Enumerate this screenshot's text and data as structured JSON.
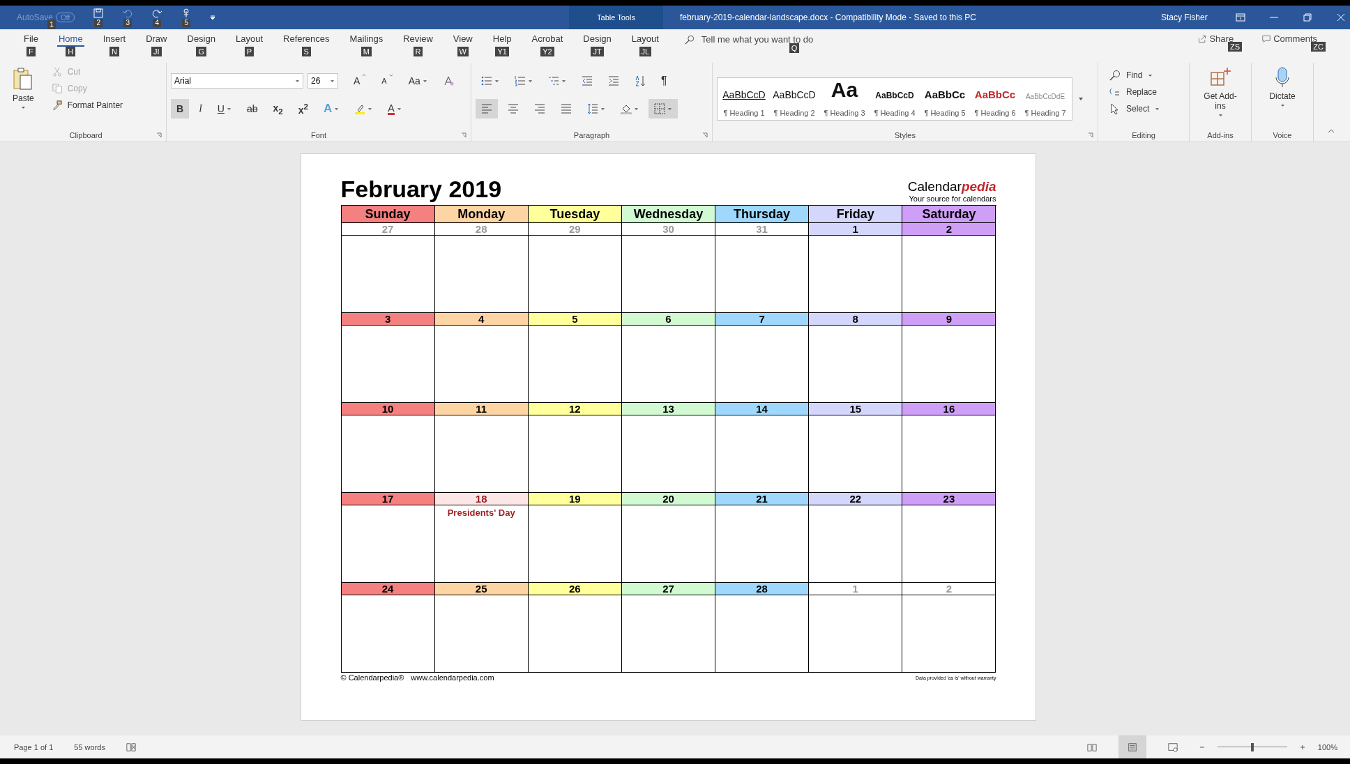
{
  "title_bar": {
    "autosave": {
      "label": "AutoSave",
      "keytip": "1",
      "on": false,
      "state_text": "Off"
    },
    "quick_access": [
      {
        "kind": "save",
        "keytip": "2",
        "disabled": false
      },
      {
        "kind": "undo",
        "keytip": "3",
        "disabled": true
      },
      {
        "kind": "redo",
        "keytip": "4",
        "disabled": false
      },
      {
        "kind": "touch",
        "keytip": "5",
        "disabled": false
      }
    ],
    "context_label": "Table Tools",
    "document_title": "february-2019-calendar-landscape.docx  -  Compatibility Mode  -  Saved to this PC",
    "user": "Stacy Fisher"
  },
  "tabs": [
    {
      "label": "File",
      "keytip": "F",
      "selected": false
    },
    {
      "label": "Home",
      "keytip": "H",
      "selected": true
    },
    {
      "label": "Insert",
      "keytip": "N",
      "selected": false
    },
    {
      "label": "Draw",
      "keytip": "JI",
      "selected": false
    },
    {
      "label": "Design",
      "keytip": "G",
      "selected": false
    },
    {
      "label": "Layout",
      "keytip": "P",
      "selected": false
    },
    {
      "label": "References",
      "keytip": "S",
      "selected": false
    },
    {
      "label": "Mailings",
      "keytip": "M",
      "selected": false
    },
    {
      "label": "Review",
      "keytip": "R",
      "selected": false
    },
    {
      "label": "View",
      "keytip": "W",
      "selected": false
    },
    {
      "label": "Help",
      "keytip": "Y1",
      "selected": false
    },
    {
      "label": "Acrobat",
      "keytip": "Y2",
      "selected": false
    },
    {
      "label": "Design",
      "keytip": "JT",
      "selected": false
    },
    {
      "label": "Layout",
      "keytip": "JL",
      "selected": false
    }
  ],
  "tell_me": {
    "placeholder": "Tell me what you want to do",
    "keytip": "Q"
  },
  "share": {
    "label": "Share",
    "keytip": "ZS"
  },
  "comments": {
    "label": "Comments",
    "keytip": "ZC"
  },
  "clipboard": {
    "title": "Clipboard",
    "paste": "Paste",
    "items": [
      {
        "kind": "cut",
        "label": "Cut",
        "disabled": true
      },
      {
        "kind": "copy",
        "label": "Copy",
        "disabled": true
      },
      {
        "kind": "brush",
        "label": "Format Painter",
        "disabled": false
      }
    ]
  },
  "font": {
    "title": "Font",
    "name": "Arial",
    "size": "26",
    "row1": [
      {
        "kind": "text",
        "label": "A"
      },
      {
        "kind": "text",
        "label": "A"
      },
      {
        "kind": "text",
        "label": "Aa",
        "dropdown": true
      },
      {
        "kind": "clear"
      }
    ],
    "row2": [
      {
        "kind": "text",
        "label": "B",
        "selected": true
      },
      {
        "kind": "text",
        "label": "I",
        "selected": false
      },
      {
        "kind": "text",
        "label": "U",
        "selected": false,
        "dropdown": true
      },
      {
        "kind": "text",
        "label": "ab",
        "selected": false
      },
      {
        "kind": "text",
        "label": "x$_{2}$",
        "selected": false
      },
      {
        "kind": "text",
        "label": "x$^{2}$",
        "selected": false
      },
      {
        "kind": "text",
        "label": "A",
        "selected": false,
        "dropdown": true
      },
      {
        "kind": "highlight",
        "selected": false,
        "dropdown": true
      },
      {
        "kind": "text",
        "label": "A",
        "selected": false,
        "dropdown": true
      }
    ]
  },
  "paragraph": {
    "title": "Paragraph",
    "row1": [
      {
        "kind": "bullets",
        "selected": false,
        "dropdown": true
      },
      {
        "kind": "numbering",
        "selected": false,
        "dropdown": true
      },
      {
        "kind": "multilevel",
        "selected": false,
        "dropdown": true
      },
      {
        "kind": "outdent",
        "selected": false
      },
      {
        "kind": "indent",
        "selected": false
      },
      {
        "kind": "sort",
        "selected": false
      },
      {
        "kind": "text",
        "label": "¶",
        "selected": false
      }
    ],
    "row2": [
      {
        "kind": "left",
        "selected": true
      },
      {
        "kind": "center",
        "selected": false
      },
      {
        "kind": "right",
        "selected": false
      },
      {
        "kind": "justify",
        "selected": false
      },
      {
        "kind": "spacing",
        "selected": false,
        "dropdown": true
      },
      {
        "kind": "shading",
        "selected": false,
        "dropdown": true
      },
      {
        "kind": "borders",
        "selected": true,
        "dropdown": true
      }
    ]
  },
  "styles": {
    "title": "Styles",
    "items": [
      {
        "sample": "AaBbCcD",
        "label": "¶ Heading 1",
        "kind": "h1"
      },
      {
        "sample": "AaBbCcD",
        "label": "¶ Heading 2",
        "kind": "h2"
      },
      {
        "sample": "Aa",
        "label": "¶ Heading 3",
        "kind": "h3"
      },
      {
        "sample": "AaBbCcD",
        "label": "¶ Heading 4",
        "kind": "h4"
      },
      {
        "sample": "AaBbCc",
        "label": "¶ Heading 5",
        "kind": "h5"
      },
      {
        "sample": "AaBbCc",
        "label": "¶ Heading 6",
        "kind": "h6"
      },
      {
        "sample": "AaBbCcDdE",
        "label": "¶ Heading 7",
        "kind": "h7"
      }
    ]
  },
  "editing": {
    "title": "Editing",
    "items": [
      {
        "kind": "find",
        "label": "Find",
        "dropdown": true
      },
      {
        "kind": "replace",
        "label": "Replace",
        "dropdown": false
      },
      {
        "kind": "select",
        "label": "Select",
        "dropdown": true
      }
    ]
  },
  "addins": {
    "title": "Add-ins",
    "label": "Get Add-ins"
  },
  "voice": {
    "title": "Voice",
    "label": "Dictate"
  },
  "calendar": {
    "title": "February 2019",
    "logo": {
      "main": "Calendar",
      "accent": "pedia"
    },
    "tagline": "Your source for calendars",
    "weekdays": [
      {
        "name": "Sunday",
        "color": "#f58080"
      },
      {
        "name": "Monday",
        "color": "#fdd5a5"
      },
      {
        "name": "Tuesday",
        "color": "#ffff9c"
      },
      {
        "name": "Wednesday",
        "color": "#d2fad2"
      },
      {
        "name": "Thursday",
        "color": "#9fd8fc"
      },
      {
        "name": "Friday",
        "color": "#d4d6fc"
      },
      {
        "name": "Saturday",
        "color": "#cf9ff8"
      }
    ],
    "weeks": [
      [
        {
          "day": "27",
          "kind": "outside"
        },
        {
          "day": "28",
          "kind": "outside"
        },
        {
          "day": "29",
          "kind": "outside"
        },
        {
          "day": "30",
          "kind": "outside"
        },
        {
          "day": "31",
          "kind": "outside"
        },
        {
          "day": "1",
          "kind": "normal"
        },
        {
          "day": "2",
          "kind": "normal"
        }
      ],
      [
        {
          "day": "3",
          "kind": "normal"
        },
        {
          "day": "4",
          "kind": "normal"
        },
        {
          "day": "5",
          "kind": "normal"
        },
        {
          "day": "6",
          "kind": "normal"
        },
        {
          "day": "7",
          "kind": "normal"
        },
        {
          "day": "8",
          "kind": "normal"
        },
        {
          "day": "9",
          "kind": "normal"
        }
      ],
      [
        {
          "day": "10",
          "kind": "normal"
        },
        {
          "day": "11",
          "kind": "normal"
        },
        {
          "day": "12",
          "kind": "normal"
        },
        {
          "day": "13",
          "kind": "normal"
        },
        {
          "day": "14",
          "kind": "normal"
        },
        {
          "day": "15",
          "kind": "normal"
        },
        {
          "day": "16",
          "kind": "normal"
        }
      ],
      [
        {
          "day": "17",
          "kind": "normal"
        },
        {
          "day": "18",
          "kind": "holiday",
          "color": "#fde6e6",
          "note": "Presidents' Day"
        },
        {
          "day": "19",
          "kind": "normal"
        },
        {
          "day": "20",
          "kind": "normal"
        },
        {
          "day": "21",
          "kind": "normal"
        },
        {
          "day": "22",
          "kind": "normal"
        },
        {
          "day": "23",
          "kind": "normal"
        }
      ],
      [
        {
          "day": "24",
          "kind": "normal"
        },
        {
          "day": "25",
          "kind": "normal"
        },
        {
          "day": "26",
          "kind": "normal"
        },
        {
          "day": "27",
          "kind": "normal"
        },
        {
          "day": "28",
          "kind": "normal"
        },
        {
          "day": "1",
          "kind": "outside"
        },
        {
          "day": "2",
          "kind": "outside"
        }
      ]
    ],
    "footer_left": "© Calendarpedia®",
    "footer_url": "www.calendarpedia.com",
    "footer_right": "Data provided 'as is' without warranty"
  },
  "status_bar": {
    "page": "Page 1 of 1",
    "words": "55 words",
    "views": [
      {
        "kind": "read",
        "selected": false
      },
      {
        "kind": "print",
        "selected": true
      },
      {
        "kind": "web",
        "selected": false
      }
    ],
    "zoom": {
      "level": 0.5,
      "reading": "100%"
    }
  }
}
